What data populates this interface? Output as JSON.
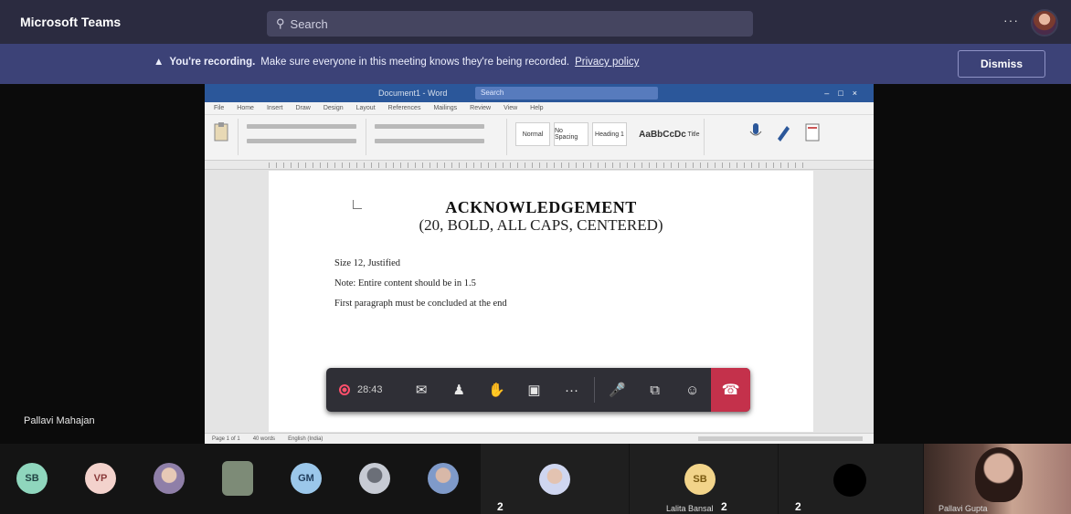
{
  "app": {
    "title": "Microsoft Teams"
  },
  "search": {
    "placeholder": "Search"
  },
  "banner": {
    "label": "You're recording.",
    "message": "Make sure everyone in this meeting knows they're being recorded.",
    "privacy_link": "Privacy policy",
    "dismiss_label": "Dismiss"
  },
  "presenter": {
    "name": "Pallavi Mahajan"
  },
  "word": {
    "doc_name": "Document1 - Word",
    "search_placeholder": "Search",
    "ribbon_tabs": [
      "File",
      "Home",
      "Insert",
      "Draw",
      "Design",
      "Layout",
      "References",
      "Mailings",
      "Review",
      "View",
      "Help"
    ],
    "styles": [
      "Normal",
      "No Spacing",
      "Heading 1",
      "AaBbCcDc",
      "Title"
    ]
  },
  "document": {
    "title": "ACKNOWLEDGEMENT",
    "subtitle": "(20, BOLD, ALL CAPS, CENTERED)",
    "lines": [
      "Size 12, Justified",
      "Note: Entire content should be in 1.5",
      "First paragraph must be concluded at the end"
    ]
  },
  "status_bar": {
    "page": "Page 1 of 1",
    "words": "40 words",
    "language": "English (India)"
  },
  "meeting_controls": {
    "timer": "28:43",
    "buttons": [
      "chat",
      "show-participants",
      "raise-hand",
      "camera",
      "more-actions",
      "mic",
      "share-tray",
      "react",
      "leave"
    ]
  },
  "participants": [
    {
      "initials": "SB",
      "color": "#8fd6bd"
    },
    {
      "initials": "VP",
      "color": "#f3d2cc"
    },
    {
      "initials": "",
      "color": "#cfd5e8"
    },
    {
      "initials": "",
      "color": "#7d8b77"
    },
    {
      "initials": "GM",
      "color": "#9bc7ea"
    },
    {
      "initials": "",
      "color": "#b8bcc6"
    },
    {
      "initials": "",
      "color": "#b9c4dd"
    }
  ],
  "wide_tiles": [
    {
      "initials": "",
      "count": "2",
      "name": "",
      "color": "#cfd6f0"
    },
    {
      "initials": "SB",
      "count": "2",
      "name": "Lalita Bansal",
      "color": "#f2d48a"
    },
    {
      "initials": "",
      "count": "2",
      "name": "",
      "color": "#000000"
    }
  ],
  "video_tile": {
    "name": "Pallavi Gupta"
  }
}
